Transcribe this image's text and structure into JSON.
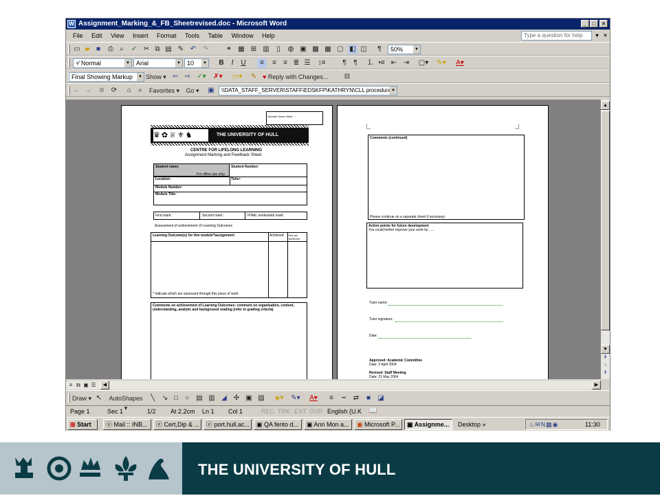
{
  "window": {
    "title": "Assignment_Marking_&_FB_Sheetrevised.doc - Microsoft Word",
    "caption_buttons": [
      "_",
      "□",
      "×"
    ]
  },
  "menu": {
    "items": [
      "File",
      "Edit",
      "View",
      "Insert",
      "Format",
      "Tools",
      "Table",
      "Window",
      "Help"
    ],
    "ask_placeholder": "Type a question for help"
  },
  "standard_toolbar": {
    "zoom": "50%"
  },
  "formatting_toolbar": {
    "style": "Normal",
    "font": "Arial",
    "size": "10"
  },
  "reviewing_toolbar": {
    "markup_mode": "Final Showing Markup",
    "show_label": "Show",
    "reply_label": "Reply with Changes..."
  },
  "web_toolbar": {
    "favorites_label": "Favorites",
    "go_label": "Go",
    "address": "\\\\DATA_STAFF_SERVER\\STAFF\\EDSKFP\\KATHRYN\\CLL procedure"
  },
  "document": {
    "page1": {
      "mark_box": "Moodle Sceen Mark →",
      "banner": "THE UNIVERSITY OF HULL",
      "centre": "CENTRE FOR LIFELONG LEARNING",
      "sheet_title": "Assignment Marking and Feedback Sheet",
      "student_name": "Student name:",
      "office_use": "For office use only:",
      "student_number": "Student Number:",
      "location": "Location:",
      "tutor": "Tutor:",
      "module_number": "Module Number:",
      "module_title": "Module Title:",
      "first_mark": "First mark:",
      "second_mark": "Second mark:",
      "final_mark": "FINAL moderated mark:",
      "assessment_heading": "Assessment of achievement of Learning Outcomes",
      "lo_col": "Learning Outcome(s) for this module*/assignment",
      "achieved_col": "Achieved",
      "not_achieved_col": "Not yet achieved",
      "lo_footnote": "* Indicate which are assessed through this piece of work",
      "comments_heading": "Comments on achievement of Learning Outcomes: comment on organisation, content, understanding, analytic and background reading (refer to grading criteria)"
    },
    "page2": {
      "comments_continued": "Comments (continued)",
      "continue_note": "Please continue on a separate sheet if necessary",
      "action_points": "Action points for future development",
      "improve_line": "You could further improve your work by …..",
      "tutor_name": "Tutor name:",
      "tutor_signature": "Tutor signature:",
      "date": "Date:",
      "approved": "Approved: Academic Committee",
      "approved_date": "Date: 2 April 2004",
      "revised": "Revised: Staff Meeting",
      "revised_date": "Date: 21 May 2004"
    }
  },
  "drawing_toolbar": {
    "draw_label": "Draw",
    "autoshapes_label": "AutoShapes"
  },
  "status": {
    "page": "Page 1",
    "sec": "Sec 1",
    "pages": "1/2",
    "at": "At 2.2cm",
    "ln": "Ln 1",
    "col": "Col 1",
    "rec": "REC",
    "trk": "TRK",
    "ext": "EXT",
    "ovr": "OVR",
    "language": "English (U.K"
  },
  "taskbar": {
    "start": "Start",
    "buttons": [
      "Mail :: INB...",
      "Cert,Dip & ...",
      "port.hull.ac...",
      "QA fento d...",
      "Ann Mon a...",
      "Microsoft P...",
      "Assignme..."
    ],
    "desktop": "Desktop",
    "clock": "11:30"
  },
  "footer": {
    "title": "THE UNIVERSITY OF HULL"
  },
  "colors": {
    "titlebar": "#0a246a",
    "footer_bg": "#0b3c45",
    "footer_crest_bg": "#b6c4cc",
    "chrome": "#d4d0c8",
    "doc_bg": "#808080"
  }
}
